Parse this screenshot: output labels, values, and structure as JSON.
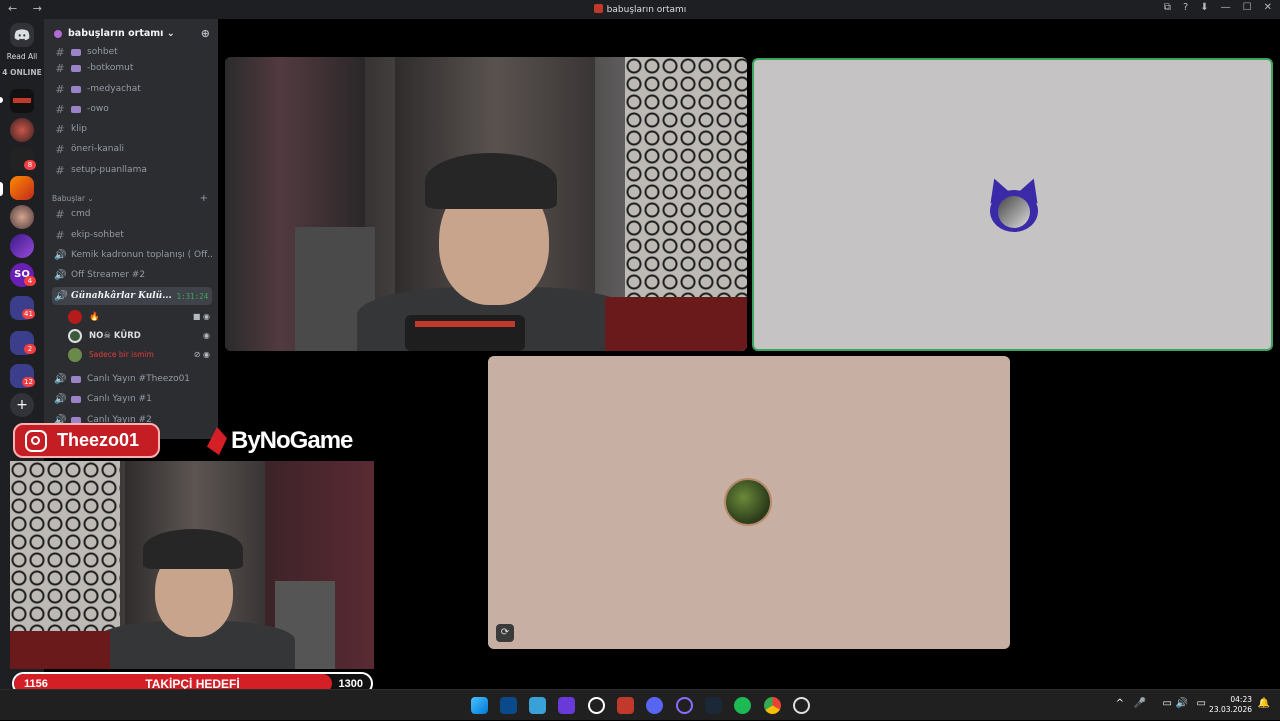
{
  "titlebar": {
    "title": "babuşların ortamı",
    "nav": "← →",
    "controls": [
      "⧉",
      "?",
      "⬇",
      "—",
      "☐",
      "✕"
    ]
  },
  "guilds": {
    "read_all": "Read All",
    "online": "4 ONLINE",
    "badges": [
      "8",
      "4",
      "41",
      "2",
      "12"
    ]
  },
  "server": {
    "name": "babuşların ortamı",
    "invite_icon": "add-member-icon"
  },
  "channels": [
    {
      "name": "sohbet",
      "type": "text",
      "emoji": true
    },
    {
      "name": "-botkomut",
      "type": "text",
      "emoji": true
    },
    {
      "name": "-medyachat",
      "type": "text",
      "emoji": true
    },
    {
      "name": "-owo",
      "type": "text",
      "emoji": true
    },
    {
      "name": "klip",
      "type": "text",
      "emoji": false
    },
    {
      "name": "öneri-kanali",
      "type": "text",
      "emoji": false
    },
    {
      "name": "setup-puanllama",
      "type": "text",
      "emoji": false
    }
  ],
  "category": {
    "name": "Babuşlar",
    "plus": "+"
  },
  "channels2": [
    {
      "name": "cmd",
      "type": "text"
    },
    {
      "name": "ekip-sohbet",
      "type": "text"
    },
    {
      "name": "Kemik kadronun toplanışı ( Off...",
      "type": "voice"
    },
    {
      "name": "Off Streamer #2",
      "type": "voice"
    }
  ],
  "active_voice": {
    "name": "Günahkârlar Kulü...",
    "time": "1:31:24"
  },
  "voice_users": [
    {
      "name": "🔥",
      "color": "#e23b3b"
    },
    {
      "name": "NO☠ KÜRD",
      "color": "#dbdee1"
    },
    {
      "name": "Sadece bir ismim",
      "color": "#e23b3b"
    }
  ],
  "channels3": [
    {
      "name": "Canlı Yayın #Theezo01",
      "type": "voice"
    },
    {
      "name": "Canlı Yayın #1",
      "type": "voice"
    },
    {
      "name": "Canlı Yayın #2",
      "type": "voice"
    }
  ],
  "overlay": {
    "instagram_handle": "Theezo01",
    "sponsor": "ByNoGame",
    "goal": {
      "current": "1156",
      "label": "TAKİPÇİ HEDEFİ",
      "target": "1300",
      "progress": 0.89
    }
  },
  "taskbar": {
    "time": "04:23",
    "date": "23.03.2026",
    "tray_caret": "^"
  },
  "colors": {
    "discord_bg": "#2b2d31",
    "goal_red": "#d41f26",
    "speaking_green": "#3ba55d"
  }
}
